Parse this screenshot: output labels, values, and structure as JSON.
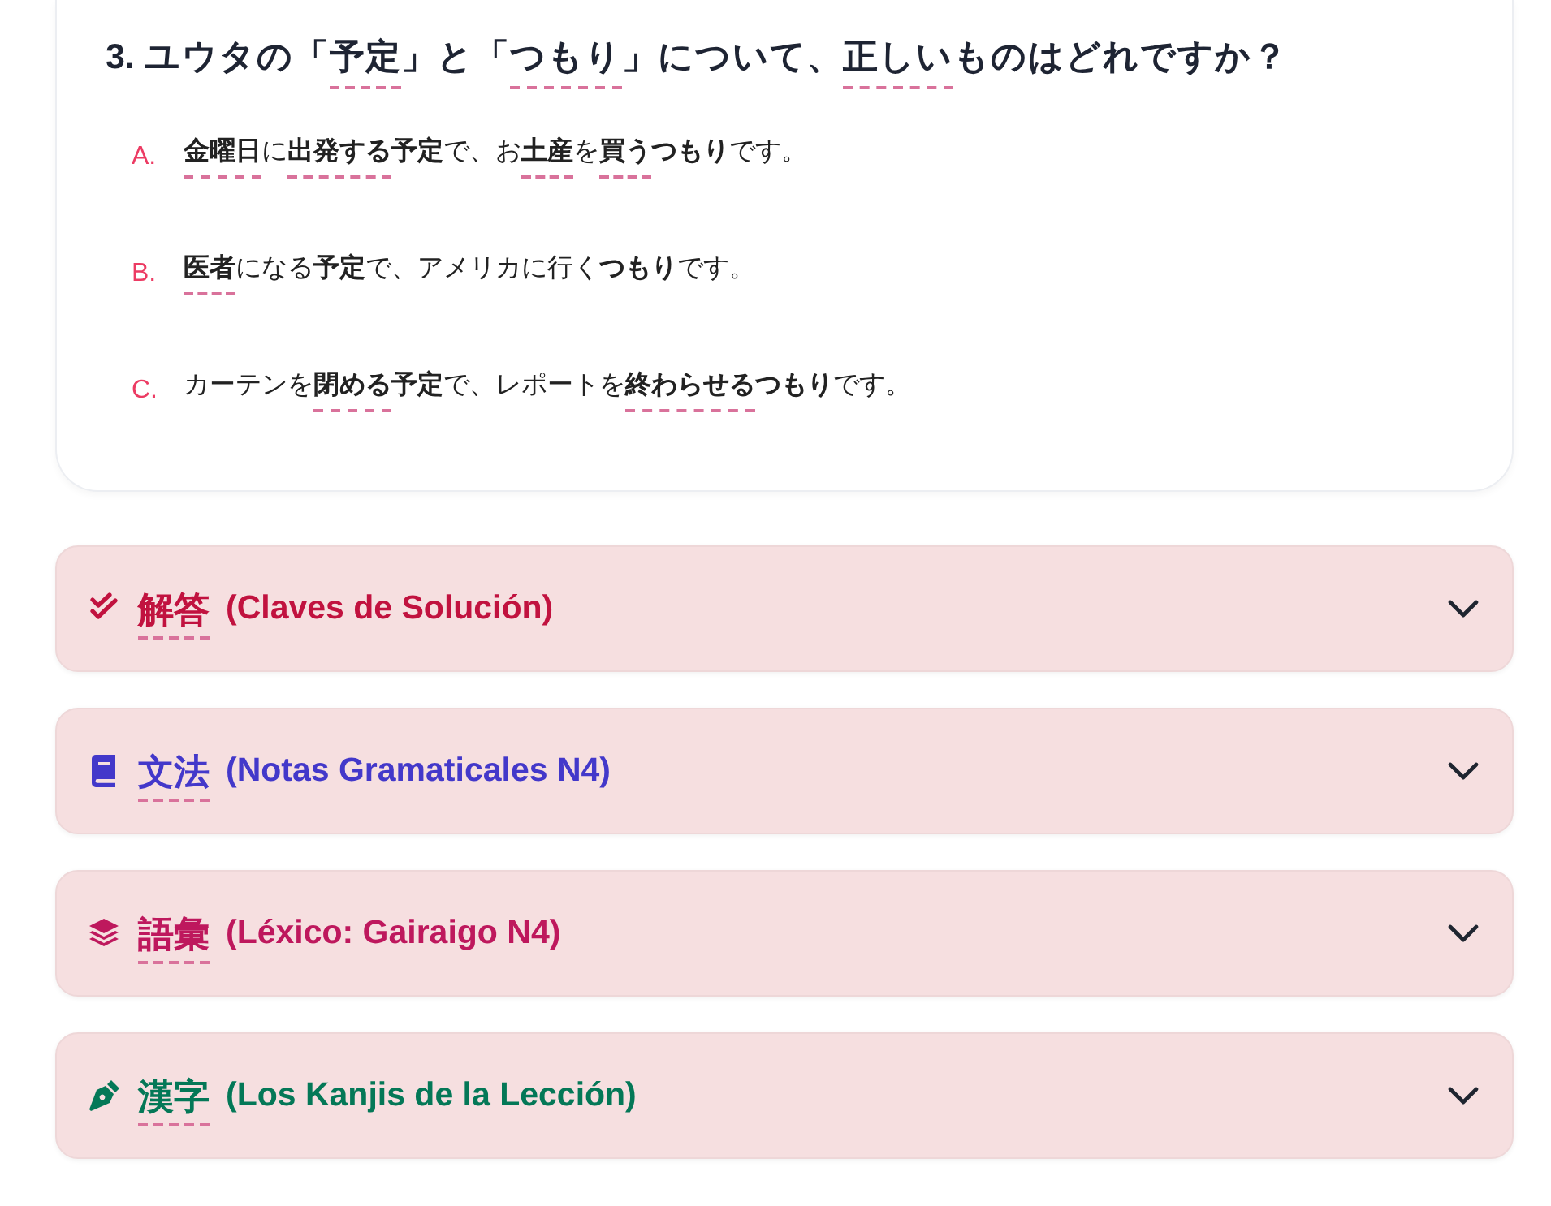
{
  "question": {
    "title": [
      {
        "text": "3. ユウタの「",
        "term": false
      },
      {
        "text": "予定",
        "term": true
      },
      {
        "text": "」と「",
        "term": false
      },
      {
        "text": "つもり",
        "term": true
      },
      {
        "text": "」について、",
        "term": false
      },
      {
        "text": "正しい",
        "term": true
      },
      {
        "text": "ものはどれですか？",
        "term": false
      }
    ]
  },
  "options": [
    {
      "letter": "A.",
      "text": [
        {
          "text": "金曜日",
          "bold": true,
          "term": true
        },
        {
          "text": "に",
          "bold": false,
          "term": false
        },
        {
          "text": "出発する",
          "bold": true,
          "term": true
        },
        {
          "text": "予定",
          "bold": true,
          "term": false
        },
        {
          "text": "で、お",
          "bold": false,
          "term": false
        },
        {
          "text": "土産",
          "bold": true,
          "term": true
        },
        {
          "text": "を",
          "bold": false,
          "term": false
        },
        {
          "text": "買う",
          "bold": true,
          "term": true
        },
        {
          "text": "つもり",
          "bold": true,
          "term": false
        },
        {
          "text": "です。",
          "bold": false,
          "term": false
        }
      ]
    },
    {
      "letter": "B.",
      "text": [
        {
          "text": "医者",
          "bold": true,
          "term": true
        },
        {
          "text": "になる",
          "bold": false,
          "term": false
        },
        {
          "text": "予定",
          "bold": true,
          "term": false
        },
        {
          "text": "で、アメリカに行く",
          "bold": false,
          "term": false
        },
        {
          "text": "つもり",
          "bold": true,
          "term": false
        },
        {
          "text": "です。",
          "bold": false,
          "term": false
        }
      ]
    },
    {
      "letter": "C.",
      "text": [
        {
          "text": "カーテンを",
          "bold": false,
          "term": false
        },
        {
          "text": "閉める",
          "bold": true,
          "term": true
        },
        {
          "text": "予定",
          "bold": true,
          "term": false
        },
        {
          "text": "で、レポートを",
          "bold": false,
          "term": false
        },
        {
          "text": "終わらせる",
          "bold": true,
          "term": true
        },
        {
          "text": "つもり",
          "bold": true,
          "term": false
        },
        {
          "text": "です。",
          "bold": false,
          "term": false
        }
      ]
    }
  ],
  "sections": [
    {
      "kind": "answers",
      "title": "解答",
      "glossed": true,
      "subtitle": "(Claves de Solución)",
      "color": "#c1123f",
      "expanded": false
    },
    {
      "kind": "grammar",
      "title": "文法",
      "glossed": true,
      "subtitle": "(Notas Gramaticales N4)",
      "color": "#4338ca",
      "expanded": false
    },
    {
      "kind": "vocabulary",
      "title": "語彙",
      "glossed": true,
      "subtitle": "(Léxico: Gairaigo N4)",
      "color": "#be185d",
      "expanded": false
    },
    {
      "kind": "kanji",
      "title": "漢字",
      "glossed": true,
      "subtitle": "(Los Kanjis de la Lección)",
      "color": "#047857",
      "expanded": false
    }
  ]
}
